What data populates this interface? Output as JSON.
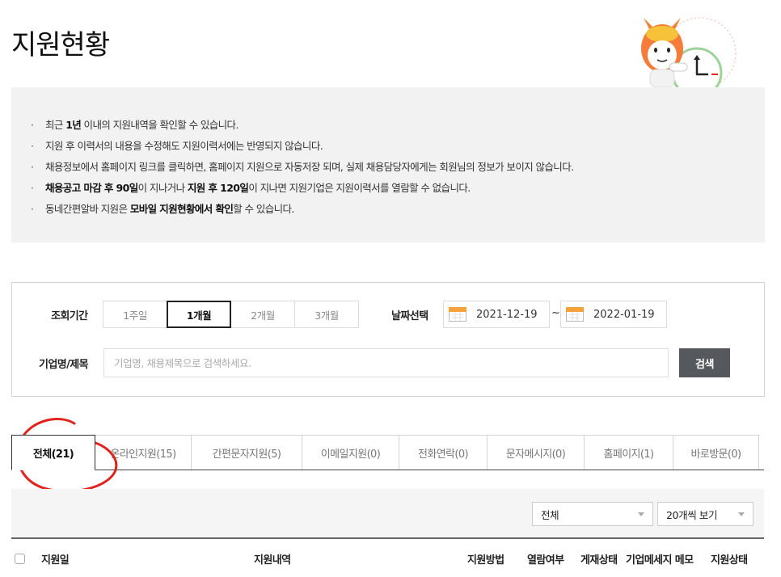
{
  "page": {
    "title": "지원현황"
  },
  "notice": {
    "items": [
      [
        {
          "t": "최근 ",
          "b": false
        },
        {
          "t": "1년",
          "b": true
        },
        {
          "t": " 이내의 지원내역을 확인할 수 있습니다.",
          "b": false
        }
      ],
      [
        {
          "t": "지원 후 이력서의 내용을 수정해도 지원이력서에는 반영되지 않습니다.",
          "b": false
        }
      ],
      [
        {
          "t": "채용정보에서 홈페이지 링크를 클릭하면, 홈페이지 지원으로 자동저장 되며, 실제 채용담당자에게는 회원님의 정보가 보이지 않습니다.",
          "b": false
        }
      ],
      [
        {
          "t": "채용공고 마감 후 90일",
          "b": true
        },
        {
          "t": "이 지나거나 ",
          "b": false
        },
        {
          "t": "지원 후 120일",
          "b": true
        },
        {
          "t": "이 지나면 지원기업은 지원이력서를 열람할 수 없습니다.",
          "b": false
        }
      ],
      [
        {
          "t": "동네간편알바 지원은 ",
          "b": false
        },
        {
          "t": "모바일 지원현황에서 확인",
          "b": true
        },
        {
          "t": "할 수 있습니다.",
          "b": false
        }
      ]
    ]
  },
  "search": {
    "period_label": "조회기간",
    "periods": [
      "1주일",
      "1개월",
      "2개월",
      "3개월"
    ],
    "period_selected": 1,
    "date_label": "날짜선택",
    "date_from": "2021-12-19",
    "date_sep": "~",
    "date_to": "2022-01-19",
    "keyword_label": "기업명/제목",
    "keyword_placeholder": "기업명, 채용제목으로 검색하세요.",
    "keyword_value": "",
    "search_button": "검색"
  },
  "tabs": [
    "전체(21)",
    "온라인지원(15)",
    "간편문자지원(5)",
    "이메일지원(0)",
    "전화연락(0)",
    "문자메시지(0)",
    "홈페이지(1)",
    "바로방문(0)"
  ],
  "tab_selected": 0,
  "filters": {
    "status_value": "전체",
    "page_size_value": "20개씩 보기"
  },
  "table": {
    "columns": [
      "지원일",
      "지원내역",
      "지원방법",
      "열람여부",
      "게재상태",
      "기업메세지 메모",
      "지원상태"
    ]
  },
  "colors": {
    "accent_orange": "#f6a23a",
    "annotation_red": "#e0231c",
    "search_button": "#55585d"
  }
}
